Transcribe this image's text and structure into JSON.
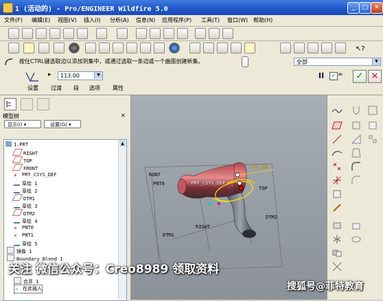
{
  "window": {
    "title": "1 (活动的) - Pro/ENGINEER Wildfire 5.0"
  },
  "menu": [
    "文件(F)",
    "编辑(E)",
    "视图(V)",
    "插入(I)",
    "分析(A)",
    "信息(N)",
    "应用程序(P)",
    "工具(T)",
    "窗口(W)",
    "帮助(H)"
  ],
  "dashboard": {
    "hint": "按住CTRL键选取边以添加到集中，或通过选取一条边或一个曲面创建新集。",
    "filter_value": "全部",
    "value_input": "113.00",
    "tabs": [
      "设置",
      "过渡",
      "段",
      "选项",
      "属性"
    ],
    "pause_icon": "pause-icon",
    "preview_label": "✓∂∂"
  },
  "model_tree": {
    "header": "模型树",
    "display_label": "显示(I)",
    "settings_label": "设置(G)",
    "items": [
      {
        "label": "1.PRT",
        "icon": "part-icon"
      },
      {
        "label": "RIGHT",
        "icon": "plane-icon"
      },
      {
        "label": "TOP",
        "icon": "plane-icon"
      },
      {
        "label": "FRONT",
        "icon": "plane-icon"
      },
      {
        "label": "PRT_CSYS_DEF",
        "icon": "csys-icon"
      },
      {
        "label": "草绘 1",
        "icon": "sketch-icon"
      },
      {
        "label": "草绘 2",
        "icon": "sketch-icon"
      },
      {
        "label": "DTM1",
        "icon": "plane-icon"
      },
      {
        "label": "草绘 3",
        "icon": "sketch-icon"
      },
      {
        "label": "DTM2",
        "icon": "plane-icon"
      },
      {
        "label": "草绘 4",
        "icon": "sketch-icon"
      },
      {
        "label": "PNT0",
        "icon": "point-icon"
      },
      {
        "label": "PNT1",
        "icon": "point-icon"
      },
      {
        "label": "草绘 5",
        "icon": "sketch-icon"
      },
      {
        "label": "镜像 1",
        "icon": "mirror-icon"
      },
      {
        "label": "Boundary Blend 1",
        "icon": "blend-icon"
      },
      {
        "label": "合并 1",
        "icon": "merge-icon"
      },
      {
        "label": "在此插入",
        "icon": "insert-icon"
      }
    ]
  },
  "viewport": {
    "labels": [
      "RONT",
      "PNT0",
      "PRT_CSYS_DEF",
      "TOP",
      "RIGHT",
      "DTM1",
      "DTM2",
      "113.00"
    ]
  },
  "watermarks": {
    "main": "关注 微信公众号：Creo8989 领取资料",
    "corner": "搜狐号@菲特教育"
  },
  "colors": {
    "title_blue": "#1f55c9",
    "accent_yellow": "#f5e400",
    "model_red": "#c9484e"
  }
}
